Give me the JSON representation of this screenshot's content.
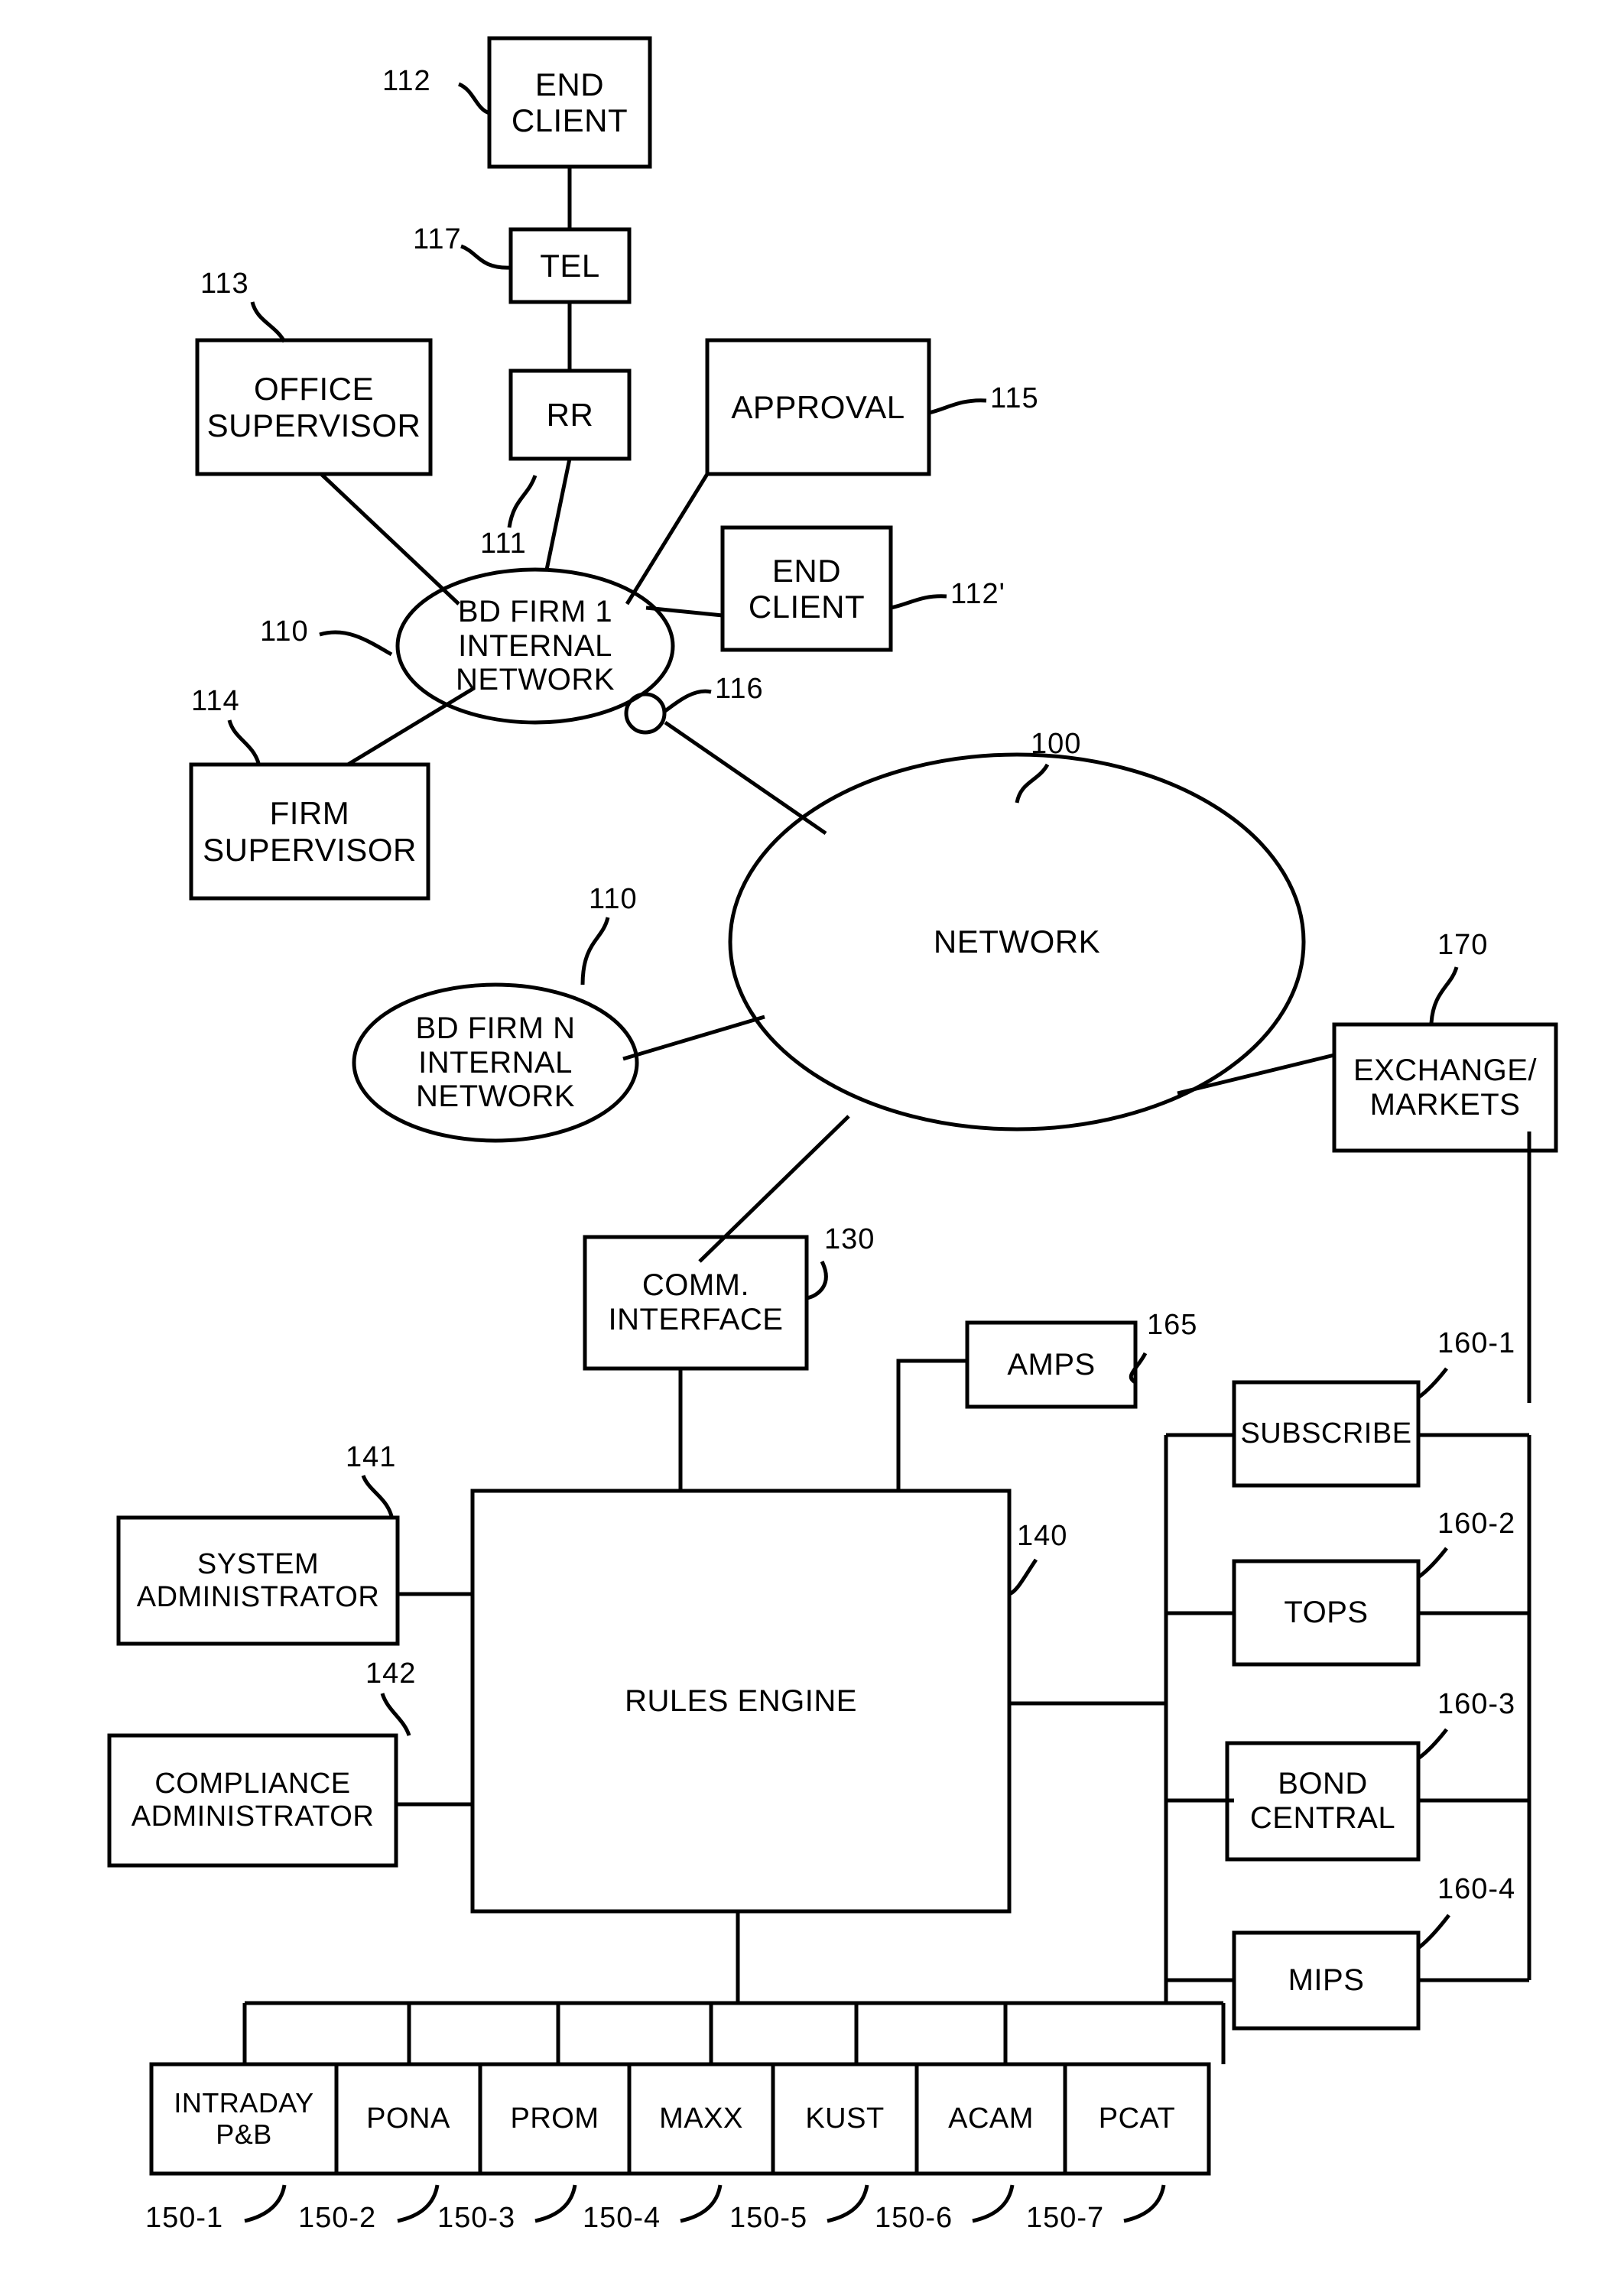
{
  "figure": {
    "type": "patent-block-diagram",
    "background_color": "#ffffff",
    "line_color": "#000000",
    "stroke_width_px": 5
  },
  "nodes": {
    "end_client_top": {
      "label": "END\nCLIENT",
      "shape": "rect",
      "ref": "112"
    },
    "tel": {
      "label": "TEL",
      "shape": "rect",
      "ref": "117"
    },
    "rr": {
      "label": "RR",
      "shape": "rect",
      "ref": "111"
    },
    "office_supervisor": {
      "label": "OFFICE\nSUPERVISOR",
      "shape": "rect",
      "ref": "113"
    },
    "approval": {
      "label": "APPROVAL",
      "shape": "rect",
      "ref": "115"
    },
    "end_client_prime": {
      "label": "END\nCLIENT",
      "shape": "rect",
      "ref": "112'"
    },
    "bd_firm_1": {
      "label": "BD FIRM 1\nINTERNAL\nNETWORK",
      "shape": "ellipse",
      "ref": "110"
    },
    "firm_supervisor": {
      "label": "FIRM\nSUPERVISOR",
      "shape": "rect",
      "ref": "114"
    },
    "gateway_node": {
      "label": "",
      "shape": "circle",
      "ref": "116"
    },
    "network": {
      "label": "NETWORK",
      "shape": "ellipse",
      "ref": "100"
    },
    "bd_firm_n": {
      "label": "BD FIRM N\nINTERNAL\nNETWORK",
      "shape": "ellipse",
      "ref": "110"
    },
    "exchange_markets": {
      "label": "EXCHANGE/\nMARKETS",
      "shape": "rect",
      "ref": "170"
    },
    "comm_interface": {
      "label": "COMM.\nINTERFACE",
      "shape": "rect",
      "ref": "130"
    },
    "amps": {
      "label": "AMPS",
      "shape": "rect",
      "ref": "165"
    },
    "rules_engine": {
      "label": "RULES ENGINE",
      "shape": "rect",
      "ref": "140"
    },
    "system_administrator": {
      "label": "SYSTEM\nADMINISTRATOR",
      "shape": "rect",
      "ref": "141"
    },
    "compliance_administrator": {
      "label": "COMPLIANCE\nADMINISTRATOR",
      "shape": "rect",
      "ref": "142"
    },
    "subscribe": {
      "label": "SUBSCRIBE",
      "shape": "rect",
      "ref": "160-1"
    },
    "tops": {
      "label": "TOPS",
      "shape": "rect",
      "ref": "160-2"
    },
    "bond_central": {
      "label": "BOND\nCENTRAL",
      "shape": "rect",
      "ref": "160-3"
    },
    "mips": {
      "label": "MIPS",
      "shape": "rect",
      "ref": "160-4"
    }
  },
  "bottom_row": [
    {
      "label": "INTRADAY\nP&B",
      "ref": "150-1"
    },
    {
      "label": "PONA",
      "ref": "150-2"
    },
    {
      "label": "PROM",
      "ref": "150-3"
    },
    {
      "label": "MAXX",
      "ref": "150-4"
    },
    {
      "label": "KUST",
      "ref": "150-5"
    },
    {
      "label": "ACAM",
      "ref": "150-6"
    },
    {
      "label": "PCAT",
      "ref": "150-7"
    }
  ],
  "reference_numerals": [
    "112",
    "117",
    "113",
    "115",
    "112'",
    "111",
    "110",
    "114",
    "116",
    "100",
    "110",
    "170",
    "130",
    "165",
    "140",
    "141",
    "142",
    "160-1",
    "160-2",
    "160-3",
    "160-4",
    "150-1",
    "150-2",
    "150-3",
    "150-4",
    "150-5",
    "150-6",
    "150-7"
  ]
}
